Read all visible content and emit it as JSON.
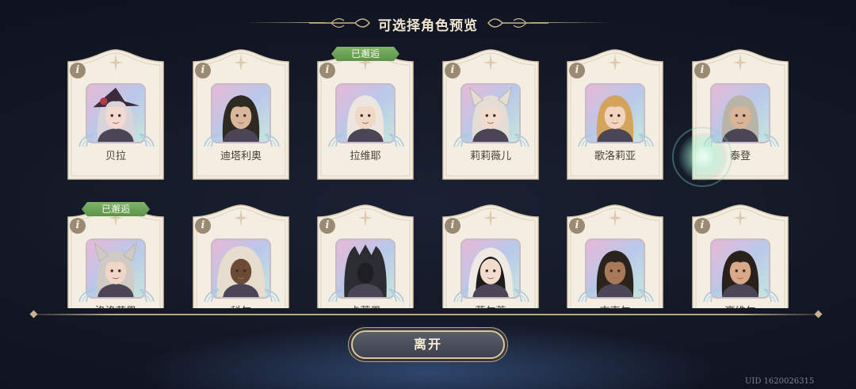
{
  "header": {
    "title": "可选择角色预览"
  },
  "info_label": "i",
  "badge_label": "已邂逅",
  "row1": [
    {
      "name": "贝拉",
      "badge": false,
      "icon": "bella-portrait-icon",
      "hair": "#d9d3dc",
      "hat": true,
      "skin": "#f3d9cf"
    },
    {
      "name": "迪塔利奥",
      "badge": false,
      "icon": "ditalio-portrait-icon",
      "hair": "#2d2a22",
      "skin": "#d8b79a"
    },
    {
      "name": "拉维耶",
      "badge": true,
      "icon": "laviye-portrait-icon",
      "hair": "#ece6df",
      "skin": "#f0d8c6"
    },
    {
      "name": "莉莉薇儿",
      "badge": false,
      "icon": "liliweier-portrait-icon",
      "hair": "#e3ddd6",
      "ears": true,
      "skin": "#f2dccd"
    },
    {
      "name": "歌洛莉亚",
      "badge": false,
      "icon": "gloria-portrait-icon",
      "hair": "#d4a45c",
      "skin": "#f1d6bd"
    },
    {
      "name": "泰登",
      "badge": false,
      "icon": "taideng-portrait-icon",
      "hair": "#b8b4a8",
      "skin": "#d9b497"
    }
  ],
  "row2": [
    {
      "name": "洛洛萨恩",
      "badge": true,
      "icon": "luoluosaen-portrait-icon",
      "hair": "#cfcbc4",
      "ears": true,
      "skin": "#efd6c8"
    },
    {
      "name": "科尔",
      "badge": false,
      "icon": "ke-er-portrait-icon",
      "hair": "#e6ddce",
      "hood": true,
      "skin": "#6b4a36"
    },
    {
      "name": "卡莉恩",
      "badge": false,
      "icon": "kalien-portrait-icon",
      "hair": "#2a2a30",
      "helm": true,
      "skin": "#3a3a44"
    },
    {
      "name": "菲尔蒂",
      "badge": false,
      "icon": "feierdi-portrait-icon",
      "hair": "#1d1b1c",
      "veil": true,
      "skin": "#f1dccd"
    },
    {
      "name": "吉克尔",
      "badge": false,
      "icon": "jikeer-portrait-icon",
      "hair": "#2b231d",
      "skin": "#a97a5a"
    },
    {
      "name": "豪维尔",
      "badge": false,
      "icon": "haoweier-portrait-icon",
      "hair": "#2a211c",
      "skin": "#d9a98a"
    }
  ],
  "footer": {
    "leave_label": "离开",
    "uid": "UID 1620026315"
  }
}
